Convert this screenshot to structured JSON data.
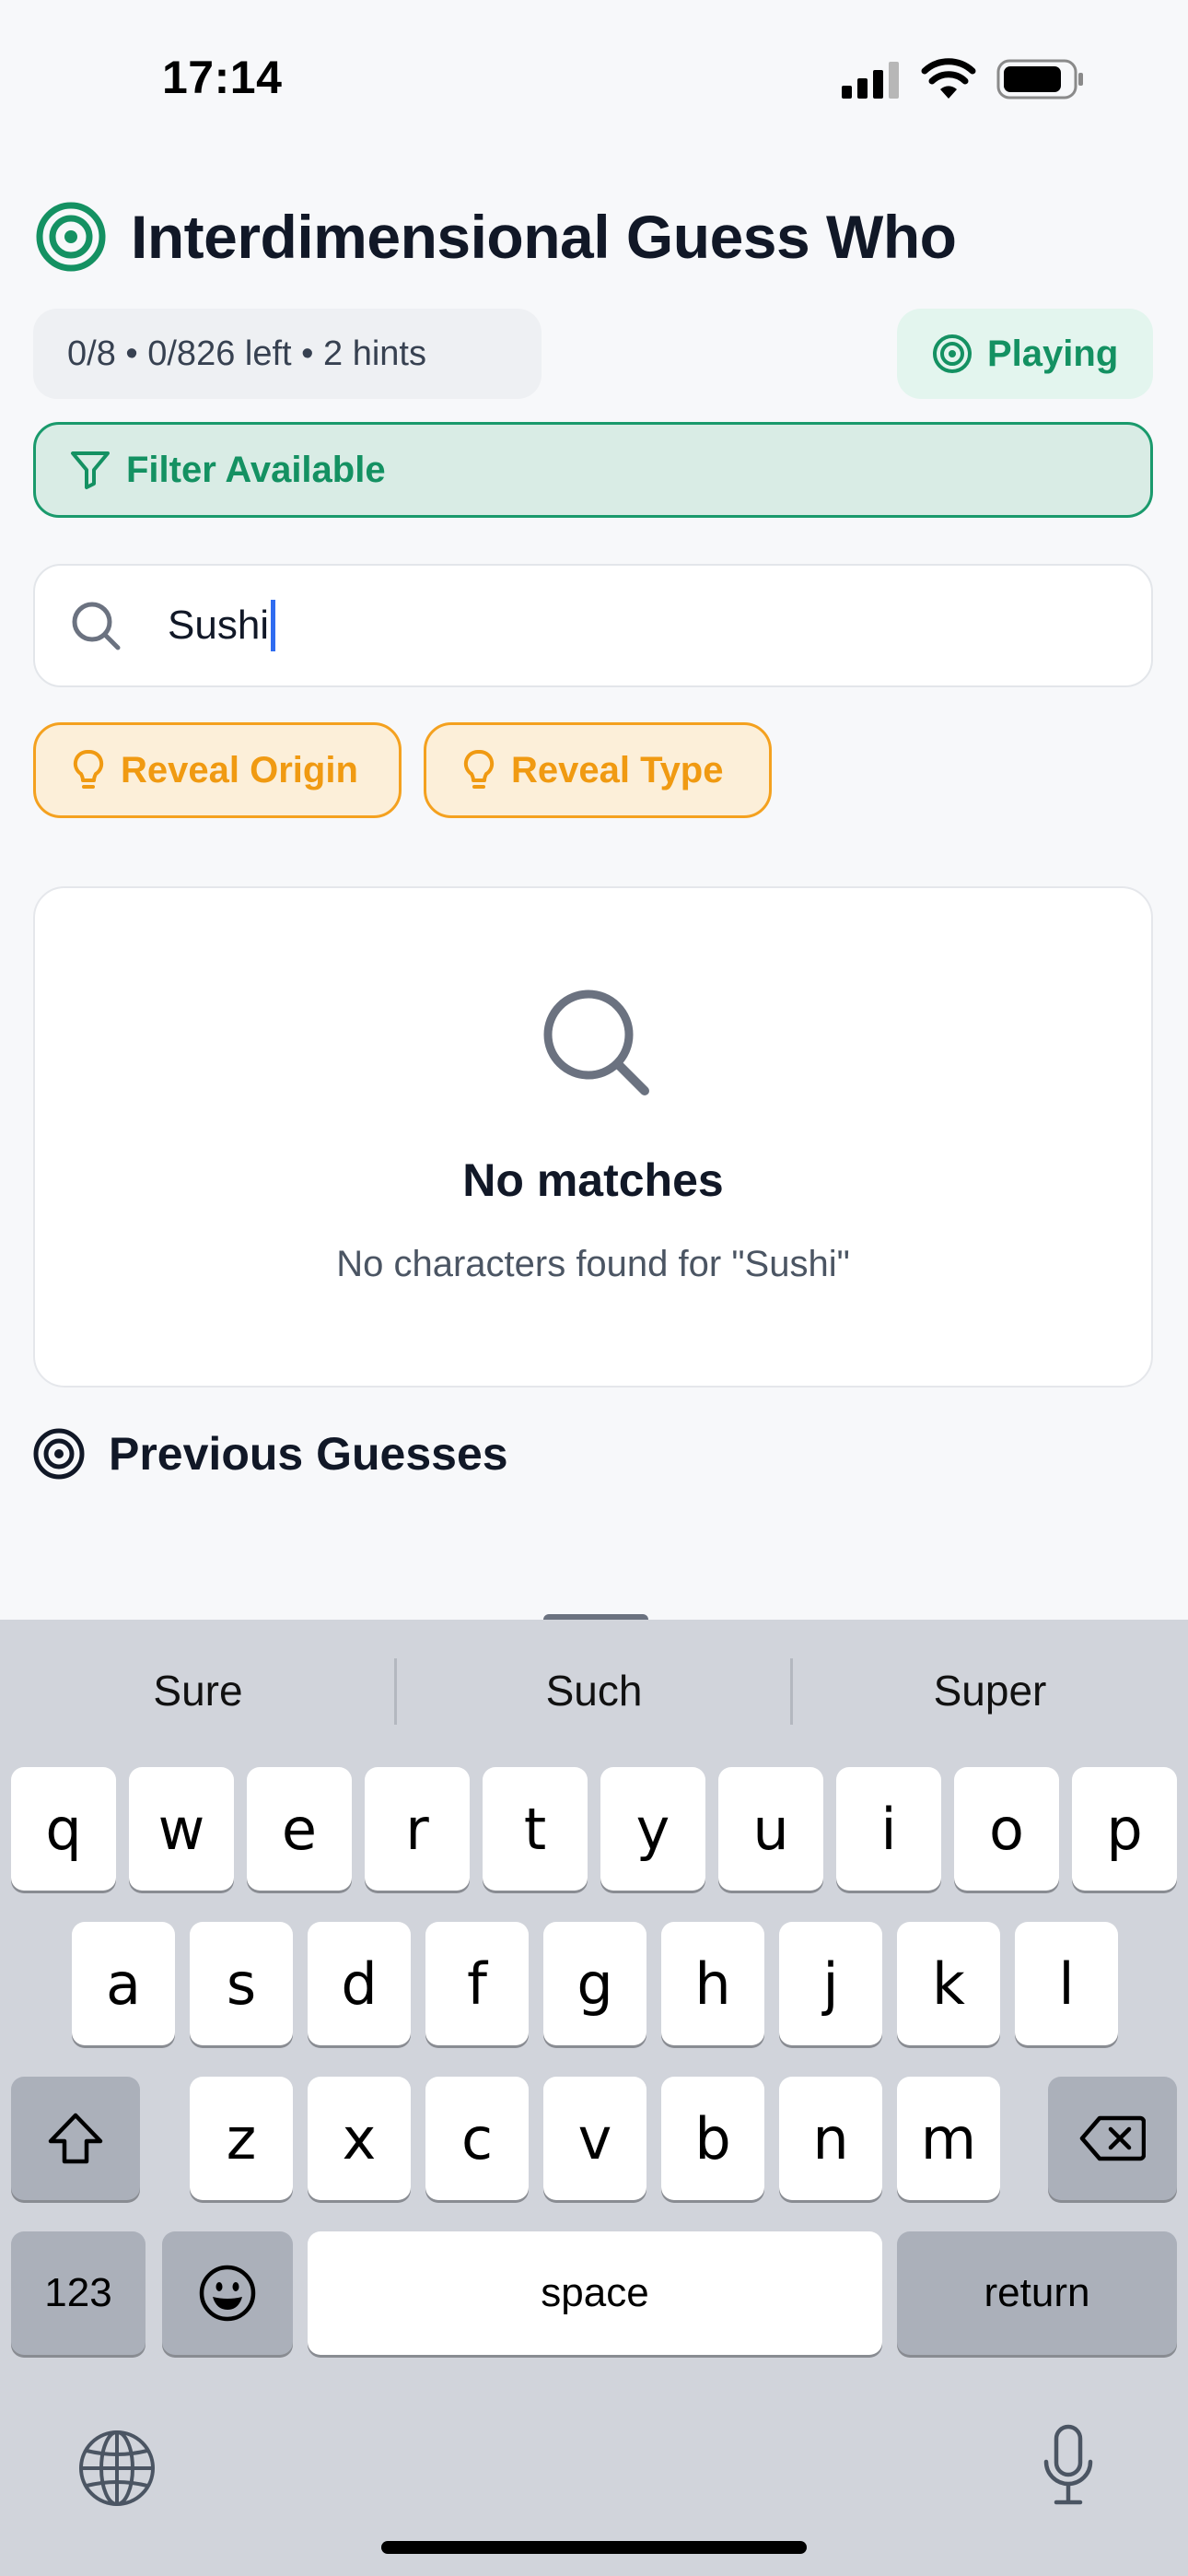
{
  "status_bar": {
    "time": "17:14"
  },
  "header": {
    "title": "Interdimensional Guess Who",
    "stats": "0/8 • 0/826 left • 2 hints",
    "status": "Playing"
  },
  "filter": {
    "label": "Filter Available"
  },
  "search": {
    "value": "Sushi"
  },
  "hints": {
    "origin_label": "Reveal Origin",
    "type_label": "Reveal Type"
  },
  "empty_state": {
    "title": "No matches",
    "message": "No characters found for \"Sushi\""
  },
  "previous_guesses": {
    "title": "Previous Guesses"
  },
  "keyboard": {
    "suggestions": [
      "Sure",
      "Such",
      "Super"
    ],
    "row1": [
      "q",
      "w",
      "e",
      "r",
      "t",
      "y",
      "u",
      "i",
      "o",
      "p"
    ],
    "row2": [
      "a",
      "s",
      "d",
      "f",
      "g",
      "h",
      "j",
      "k",
      "l"
    ],
    "row3": [
      "z",
      "x",
      "c",
      "v",
      "b",
      "n",
      "m"
    ],
    "numbers_label": "123",
    "space_label": "space",
    "return_label": "return"
  },
  "colors": {
    "accent_green": "#149162",
    "accent_amber": "#f09a12",
    "caret_blue": "#2f6cf0"
  },
  "icons": {
    "status": [
      "signal-icon",
      "wifi-icon",
      "battery-icon"
    ],
    "app": "target-icon",
    "filter": "funnel-icon",
    "search": "search-icon",
    "hint": "lightbulb-icon",
    "keyboard": [
      "shift-icon",
      "delete-icon",
      "emoji-icon",
      "globe-icon",
      "microphone-icon"
    ]
  }
}
